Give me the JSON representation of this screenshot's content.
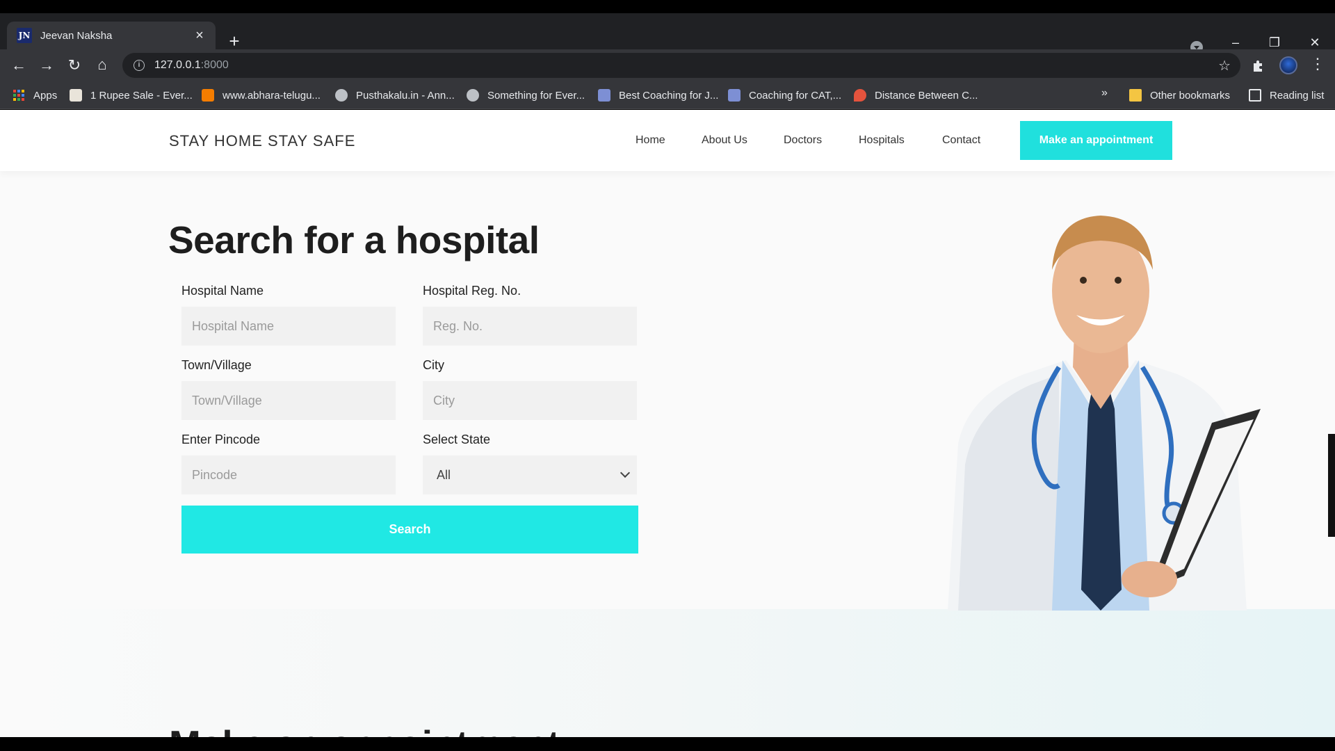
{
  "browser": {
    "tab": {
      "favicon_text": "JN",
      "title": "Jeevan Naksha"
    },
    "url": {
      "host": "127.0.0.1",
      "port": ":8000"
    },
    "bookmarks": [
      {
        "label": "Apps",
        "icon": "apps-grid-icon"
      },
      {
        "label": "1 Rupee Sale - Ever...",
        "icon": "tag-icon"
      },
      {
        "label": "www.abhara-telugu...",
        "icon": "blogger-icon"
      },
      {
        "label": "Pusthakalu.in - Ann...",
        "icon": "globe-icon"
      },
      {
        "label": "Something for Ever...",
        "icon": "globe-icon"
      },
      {
        "label": "Best Coaching for J...",
        "icon": "school-icon"
      },
      {
        "label": "Coaching for CAT,...",
        "icon": "school-icon"
      },
      {
        "label": "Distance Between C...",
        "icon": "route-icon"
      }
    ],
    "more_bookmarks": "»",
    "other_bookmarks": "Other bookmarks",
    "reading_list": "Reading list"
  },
  "site": {
    "brand": "STAY HOME STAY SAFE",
    "nav": [
      "Home",
      "About Us",
      "Doctors",
      "Hospitals",
      "Contact"
    ],
    "cta": "Make an appointment"
  },
  "search_form": {
    "title": "Search for a hospital",
    "fields": {
      "hospital_name": {
        "label": "Hospital Name",
        "placeholder": "Hospital Name",
        "value": ""
      },
      "reg_no": {
        "label": "Hospital Reg. No.",
        "placeholder": "Reg. No.",
        "value": ""
      },
      "town": {
        "label": "Town/Village",
        "placeholder": "Town/Village",
        "value": ""
      },
      "city": {
        "label": "City",
        "placeholder": "City",
        "value": ""
      },
      "pincode": {
        "label": "Enter Pincode",
        "placeholder": "Pincode",
        "value": ""
      },
      "state": {
        "label": "Select State",
        "selected": "All"
      }
    },
    "submit": "Search"
  },
  "next_section": {
    "title": "Make an appointment"
  },
  "colors": {
    "accent": "#20e0dd",
    "chrome_dark": "#202124",
    "chrome_mid": "#35363a"
  }
}
